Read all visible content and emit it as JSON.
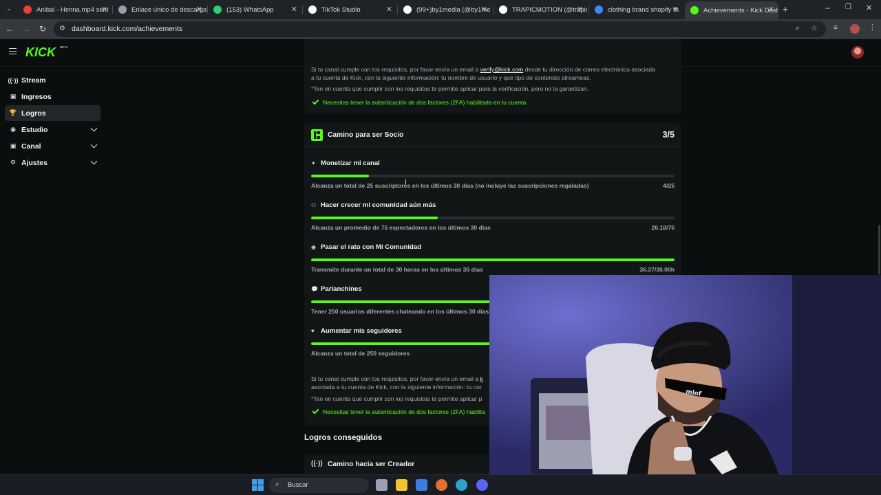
{
  "browser": {
    "tabs": [
      {
        "title": "Anibal - Henna.mp4 sent",
        "icon": "gmail-icon",
        "color": "#ea4335"
      },
      {
        "title": "Enlace único de descarga",
        "icon": "globe-icon",
        "color": "#9aa0a6"
      },
      {
        "title": "(153) WhatsApp",
        "icon": "whatsapp-icon",
        "color": "#25d366"
      },
      {
        "title": "TikTok Studio",
        "icon": "tiktok-icon",
        "color": "#ffffff"
      },
      {
        "title": "(99+)by1media (@by1me",
        "icon": "tiktok-icon",
        "color": "#ffffff"
      },
      {
        "title": "TRAPICMOTION (@trapic",
        "icon": "tiktok-icon",
        "color": "#ffffff"
      },
      {
        "title": "clothing brand shopify th",
        "icon": "google-icon",
        "color": "#4285f4"
      },
      {
        "title": "Achievements - Kick Dash",
        "icon": "kick-icon",
        "color": "#53fc18",
        "active": true
      }
    ],
    "url": "dashboard.kick.com/achievements"
  },
  "kick": {
    "logo": "KICK",
    "beta": "BETA",
    "sidebar": [
      {
        "label": "Stream",
        "icon": "stream-icon",
        "glyph": "((·))"
      },
      {
        "label": "Ingresos",
        "icon": "revenue-icon",
        "glyph": "▣"
      },
      {
        "label": "Logros",
        "icon": "trophy-icon",
        "glyph": "🏆",
        "active": true
      },
      {
        "label": "Estudio",
        "icon": "studio-icon",
        "glyph": "◉",
        "expandable": true
      },
      {
        "label": "Canal",
        "icon": "channel-icon",
        "glyph": "▣",
        "expandable": true
      },
      {
        "label": "Ajustes",
        "icon": "settings-icon",
        "glyph": "⚙",
        "expandable": true
      }
    ],
    "top_card": {
      "line1_pre": "Si tu canal cumple con los requisitos, por favor envía un email a ",
      "email": "verify@kick.com",
      "line1_post": " desde tu dirección de correo electrónico asociada",
      "line2": "a tu cuenta de Kick, con la siguiente información: tu nombre de usuario y qué tipo de contenido streameas.",
      "note": "*Ten en cuenta que cumplir con los requisitos te permite aplicar para la verificación, pero no la garantizan.",
      "twofa": "Necesitas tener la autenticación de dos factores (2FA) habilitada en tu cuenta"
    },
    "partner": {
      "title": "Camino para ser Socio",
      "progress": "3/5",
      "achievements": [
        {
          "title": "Monetizar mi canal",
          "icon": "sparkle-icon",
          "glyph": "✦",
          "desc": "Alcanza un total de 25 suscriptores en los últimos 30 días (no incluye las suscripciones regaladas)",
          "count": "4/25",
          "fraction": 0.16
        },
        {
          "title": "Hacer crecer mi comunidad aún más",
          "icon": "community-icon",
          "glyph": "⚇",
          "desc": "Alcanza un promedio de 75 espectadores en los últimos 30 días",
          "count": "26.18/75",
          "fraction": 0.349
        },
        {
          "title": "Pasar el rato con Mi Comunidad",
          "icon": "broadcast-icon",
          "glyph": "◉",
          "desc": "Transmite durante un total de 30 horas en los últimos 30 días",
          "count": "36.37/30.00h",
          "fraction": 1.0
        },
        {
          "title": "Parlanchines",
          "icon": "chat-icon",
          "glyph": "💬",
          "desc": "Tener 250 usuarios diferentes chateando en los últimos 30 días",
          "count": "",
          "fraction": 1.0
        },
        {
          "title": "Aumentar mis seguidores",
          "icon": "heart-icon",
          "glyph": "♥",
          "desc": "Alcanza un total de 250 seguidores",
          "count": "",
          "fraction": 1.0
        }
      ],
      "footer_line1_pre": "Si tu canal cumple con los requisitos, por favor envía un email a ",
      "footer_email": "k",
      "footer_line2": "asociada a tu cuenta de Kick, con la siguiente información: tu nor",
      "footer_note": "*Ten en cuenta que cumplir con los requisitos te permite aplicar p",
      "footer_twofa": "Necesitas tener la autenticación de dos factores (2FA) habilita"
    },
    "earned_heading": "Logros conseguidos",
    "creator_card_title": "Camino hacia ser Creador"
  },
  "taskbar": {
    "search_placeholder": "Buscar"
  },
  "colors": {
    "kick_green": "#53fc18",
    "page_bg": "#0b0e0f",
    "card_bg": "#131617"
  }
}
